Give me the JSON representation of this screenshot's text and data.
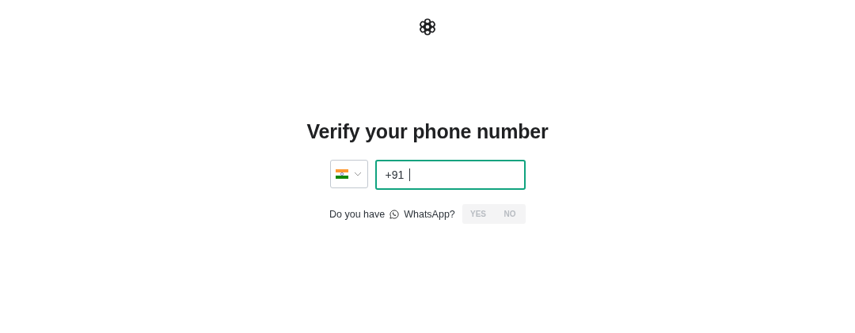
{
  "heading": "Verify your phone number",
  "country_select": {
    "expanded": false
  },
  "phone_field": {
    "value": "+91",
    "focused": true
  },
  "whatsapp": {
    "before": "Do you have",
    "label": "WhatsApp?"
  },
  "choices": [
    {
      "label": "YES",
      "selected": false
    },
    {
      "label": "NO",
      "selected": false
    }
  ]
}
